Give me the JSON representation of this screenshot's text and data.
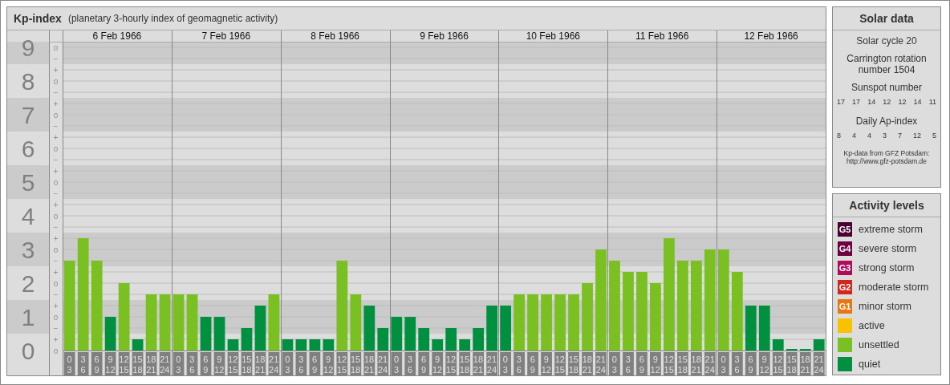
{
  "kp_panel": {
    "title": "Kp-index",
    "subtitle": "(planetary 3-hourly index of geomagnetic activity)",
    "minor_labels": [
      "o",
      "−",
      "+",
      "o",
      "−",
      "+",
      "o",
      "−",
      "+",
      "o",
      "−",
      "+",
      "o",
      "−",
      "+",
      "o",
      "−",
      "+",
      "o",
      "−",
      "+",
      "o",
      "−",
      "+",
      "o",
      "−",
      "+",
      "o"
    ],
    "days": [
      "6 Feb 1966",
      "7 Feb 1966",
      "8 Feb 1966",
      "9 Feb 1966",
      "10 Feb 1966",
      "11 Feb 1966",
      "12 Feb 1966"
    ],
    "chart_data": {
      "type": "bar",
      "ylim": [
        0,
        9
      ],
      "yticks": [
        0,
        1,
        2,
        3,
        4,
        5,
        6,
        7,
        8,
        9
      ],
      "grid": true,
      "categories": [
        "0 3",
        "3 6",
        "6 9",
        "9 12",
        "12 15",
        "15 18",
        "18 21",
        "21 24",
        "0 3",
        "3 6",
        "6 9",
        "9 12",
        "12 15",
        "15 18",
        "18 21",
        "21 24",
        "0 3",
        "3 6",
        "6 9",
        "9 12",
        "12 15",
        "15 18",
        "18 21",
        "21 24",
        "0 3",
        "3 6",
        "6 9",
        "9 12",
        "12 15",
        "15 18",
        "18 21",
        "21 24",
        "0 3",
        "3 6",
        "6 9",
        "9 12",
        "12 15",
        "15 18",
        "18 21",
        "21 24",
        "0 3",
        "3 6",
        "6 9",
        "9 12",
        "12 15",
        "15 18",
        "18 21",
        "21 24",
        "0 3",
        "3 6",
        "6 9",
        "9 12",
        "12 15",
        "15 18",
        "18 21",
        "21 24"
      ],
      "values": [
        2.67,
        3.33,
        2.67,
        1,
        2,
        0.33,
        1.67,
        1.67,
        1.67,
        1.67,
        1,
        1,
        0.33,
        0.67,
        1.33,
        1.67,
        0.33,
        0.33,
        0.33,
        0.33,
        2.67,
        1.67,
        1.33,
        0.67,
        1,
        1,
        0.67,
        0.33,
        0.67,
        0.33,
        0.67,
        1.33,
        1.33,
        1.67,
        1.67,
        1.67,
        1.67,
        1.67,
        2,
        3,
        2.67,
        2.33,
        2.33,
        2,
        3.33,
        2.67,
        2.67,
        3,
        3,
        2.33,
        1.33,
        1.33,
        0.33,
        0,
        0,
        0.33
      ]
    }
  },
  "solar_data": {
    "title": "Solar data",
    "solar_cycle": "Solar cycle 20",
    "carrington": "Carrington rotation number 1504",
    "sunspot_title": "Sunspot number",
    "sunspot_values": [
      "17",
      "17",
      "14",
      "12",
      "12",
      "14",
      "11"
    ],
    "ap_title": "Daily Ap-index",
    "ap_values": [
      "8",
      "4",
      "4",
      "3",
      "7",
      "12",
      "5"
    ],
    "source": "Kp-data from GFZ Potsdam:",
    "source_url": "http://www.gfz-potsdam.de"
  },
  "activity_levels": {
    "title": "Activity levels",
    "items": [
      {
        "badge": "G5",
        "label": "extreme storm",
        "color": "#4a0030"
      },
      {
        "badge": "G4",
        "label": "severe storm",
        "color": "#6e0040"
      },
      {
        "badge": "G3",
        "label": "strong storm",
        "color": "#b00c5a"
      },
      {
        "badge": "G2",
        "label": "moderate storm",
        "color": "#d0281c"
      },
      {
        "badge": "G1",
        "label": "minor storm",
        "color": "#e87612"
      },
      {
        "label": "active",
        "color": "#f8c200"
      },
      {
        "label": "unsettled",
        "color": "#7ac022"
      },
      {
        "label": "quiet",
        "color": "#009040"
      }
    ]
  }
}
